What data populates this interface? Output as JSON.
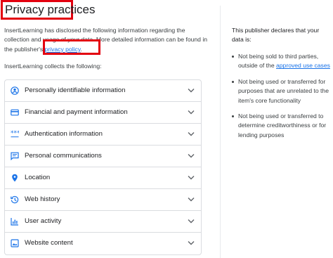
{
  "page": {
    "title": "Privacy practices",
    "intro_part1": "InsertLearning has disclosed the following information regarding the collection and usage of your data. More detailed information can be found in the publisher's ",
    "privacy_link": "privacy policy",
    "intro_part2": ".",
    "collects_text": "InsertLearning collects the following:"
  },
  "data_types": [
    {
      "label": "Personally identifiable information",
      "icon": "person-icon"
    },
    {
      "label": "Financial and payment information",
      "icon": "credit-card-icon"
    },
    {
      "label": "Authentication information",
      "icon": "password-icon"
    },
    {
      "label": "Personal communications",
      "icon": "message-icon"
    },
    {
      "label": "Location",
      "icon": "location-pin-icon"
    },
    {
      "label": "Web history",
      "icon": "history-icon"
    },
    {
      "label": "User activity",
      "icon": "activity-chart-icon"
    },
    {
      "label": "Website content",
      "icon": "image-icon"
    }
  ],
  "side": {
    "title": "This publisher declares that your data is:",
    "item1_pre": "Not being sold to third parties, outside of the ",
    "item1_link": "approved use cases",
    "item2": "Not being used or transferred for purposes that are unrelated to the item's core functionality",
    "item3": "Not being used or transferred to determine creditworthiness or for lending purposes"
  },
  "colors": {
    "icon_blue": "#1a73e8",
    "highlight_red": "#e3000f",
    "border": "#dadce0"
  }
}
